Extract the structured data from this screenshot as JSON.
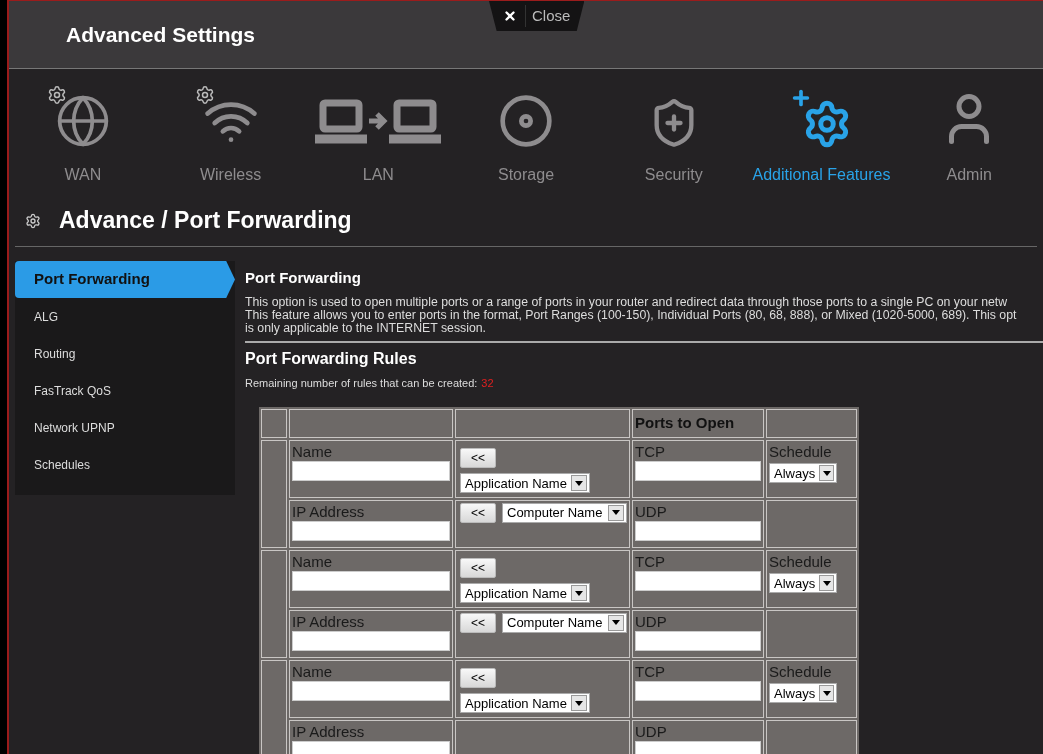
{
  "window": {
    "title": "Advanced Settings",
    "close_label": "Close"
  },
  "categories": [
    {
      "label": "WAN",
      "kind": "globe",
      "gear_badge": true,
      "selected": false
    },
    {
      "label": "Wireless",
      "kind": "wifi",
      "gear_badge": true,
      "selected": false
    },
    {
      "label": "LAN",
      "kind": "lan",
      "gear_badge": false,
      "selected": false
    },
    {
      "label": "Storage",
      "kind": "disc",
      "gear_badge": false,
      "selected": false
    },
    {
      "label": "Security",
      "kind": "shield",
      "gear_badge": false,
      "selected": false
    },
    {
      "label": "Additional Features",
      "kind": "gear-plus",
      "gear_badge": false,
      "selected": true
    },
    {
      "label": "Admin",
      "kind": "user",
      "gear_badge": false,
      "selected": false
    }
  ],
  "page_title": "Advance / Port Forwarding",
  "sidebar": {
    "items": [
      {
        "label": "Port Forwarding",
        "selected": true
      },
      {
        "label": "ALG",
        "selected": false
      },
      {
        "label": "Routing",
        "selected": false
      },
      {
        "label": "FasTrack QoS",
        "selected": false
      },
      {
        "label": "Network UPNP",
        "selected": false
      },
      {
        "label": "Schedules",
        "selected": false
      }
    ]
  },
  "section": {
    "title": "Port Forwarding",
    "description_lines": [
      "This option is used to open multiple ports or a range of ports in your router and redirect data through those ports to a single PC on your netw",
      "This feature allows you to enter ports in the format, Port Ranges (100-150), Individual Ports (80, 68, 888), or Mixed (1020-5000, 689). This opt",
      "is only applicable to the INTERNET session."
    ],
    "rules_title": "Port Forwarding Rules",
    "remaining_label": "Remaining number of rules that can be created:",
    "remaining_count": "32"
  },
  "table": {
    "header": "Ports to Open",
    "rules": [
      {
        "name_label": "Name",
        "app_button": "<<",
        "app_select": "Application Name",
        "tcp_label": "TCP",
        "schedule_label": "Schedule",
        "schedule_value": "Always",
        "ip_label": "IP Address",
        "computer_button": "<<",
        "computer_select": "Computer Name",
        "udp_label": "UDP"
      },
      {
        "name_label": "Name",
        "app_button": "<<",
        "app_select": "Application Name",
        "tcp_label": "TCP",
        "schedule_label": "Schedule",
        "schedule_value": "Always",
        "ip_label": "IP Address",
        "computer_button": "<<",
        "computer_select": "Computer Name",
        "udp_label": "UDP"
      },
      {
        "name_label": "Name",
        "app_button": "<<",
        "app_select": "Application Name",
        "tcp_label": "TCP",
        "schedule_label": "Schedule",
        "schedule_value": "Always",
        "ip_label": "IP Address",
        "udp_label": "UDP"
      }
    ]
  }
}
